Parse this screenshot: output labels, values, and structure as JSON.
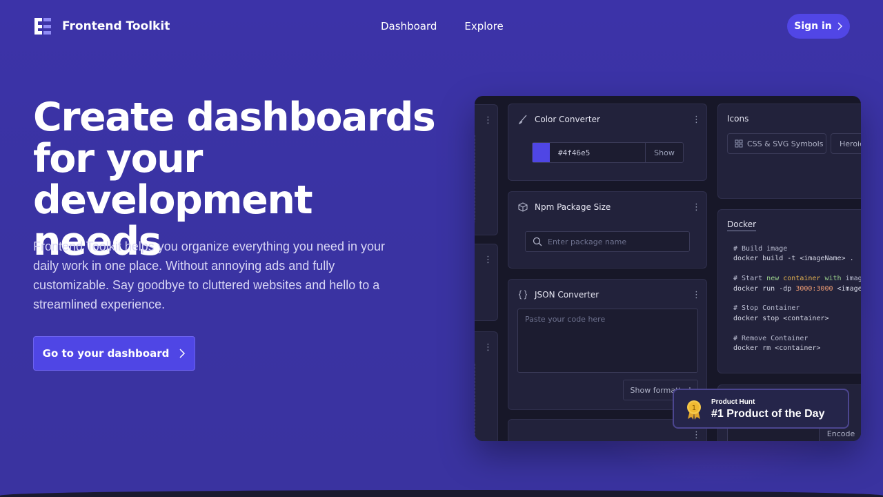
{
  "header": {
    "brand": "Frontend Toolkit",
    "nav": [
      {
        "label": "Dashboard"
      },
      {
        "label": "Explore"
      }
    ],
    "signin_label": "Sign in"
  },
  "hero": {
    "title": "Create dashboards for your development needs",
    "subtitle": "Frontend Toolkit helps you organize everything you need in your daily work in one place. Without annoying ads and fully customizable. Say goodbye to cluttered websites and hello to a streamlined experience.",
    "cta_label": "Go to your dashboard"
  },
  "preview": {
    "color_converter": {
      "title": "Color Converter",
      "value": "#4f46e5",
      "swatch_color": "#4f46e5",
      "show_label": "Show"
    },
    "npm_size": {
      "title": "Npm Package Size",
      "placeholder": "Enter package name"
    },
    "json_converter": {
      "title": "JSON Converter",
      "placeholder": "Paste your code here",
      "format_label": "Show formatted"
    },
    "icons": {
      "title": "Icons",
      "chips": [
        "CSS & SVG Symbols",
        "Heroicons"
      ]
    },
    "docker": {
      "title": "Docker",
      "lines": {
        "c1": "# Build image",
        "l1a": "docker build -t <imageName> .",
        "c2": "# Start ",
        "c2b": "new",
        "c2c": " container ",
        "c2d": "with",
        "c2e": " image",
        "l2a": "docker run -dp ",
        "l2b": "3000:3000",
        "l2c": " <imageName>",
        "c3": "# Stop Container",
        "l3a": "docker stop <container>",
        "c4": "# Remove Container",
        "l4a": "docker rm <container>"
      }
    },
    "encode_label": "Encode"
  },
  "product_hunt": {
    "small": "Product Hunt",
    "big": "#1 Product of the Day",
    "rank": "1"
  },
  "colors": {
    "background": "#3b33a6",
    "accent": "#4f46e5",
    "panel": "#171728",
    "card": "#22223b"
  }
}
